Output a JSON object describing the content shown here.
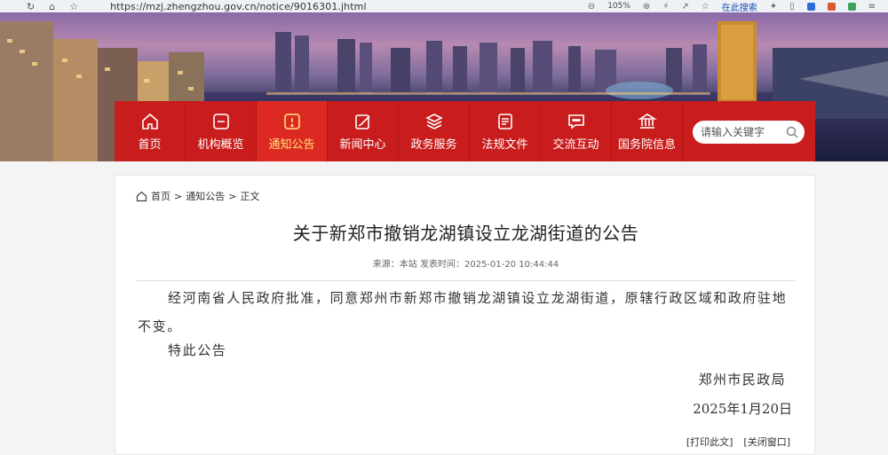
{
  "browser": {
    "url": "https://mzj.zhengzhou.gov.cn/notice/9016301.jhtml",
    "zoom": "105%",
    "search_here": "在此搜索"
  },
  "nav": {
    "items": [
      {
        "label": "首页",
        "icon": "home-icon"
      },
      {
        "label": "机构概览",
        "icon": "institution-icon"
      },
      {
        "label": "通知公告",
        "icon": "notice-icon",
        "active": true
      },
      {
        "label": "新闻中心",
        "icon": "news-icon"
      },
      {
        "label": "政务服务",
        "icon": "service-icon"
      },
      {
        "label": "法规文件",
        "icon": "document-icon"
      },
      {
        "label": "交流互动",
        "icon": "chat-icon"
      },
      {
        "label": "国务院信息",
        "icon": "state-council-icon"
      }
    ],
    "search_placeholder": "请输入关键字"
  },
  "breadcrumb": {
    "home": "首页",
    "sep": ">",
    "section": "通知公告",
    "current": "正文"
  },
  "article": {
    "title": "关于新郑市撤销龙湖镇设立龙湖街道的公告",
    "meta": "来源：本站  发表时间：2025-01-20 10:44:44",
    "paragraph1": "经河南省人民政府批准，同意郑州市新郑市撤销龙湖镇设立龙湖街道，原辖行政区域和政府驻地不变。",
    "paragraph2": "特此公告",
    "signature_org": "郑州市民政局",
    "signature_date": "2025年1月20日"
  },
  "actions": {
    "print": "[打印此文]",
    "close": "[关闭窗口]"
  },
  "colors": {
    "nav_red": "#c81d1c",
    "nav_active_text": "#ffe27a"
  }
}
